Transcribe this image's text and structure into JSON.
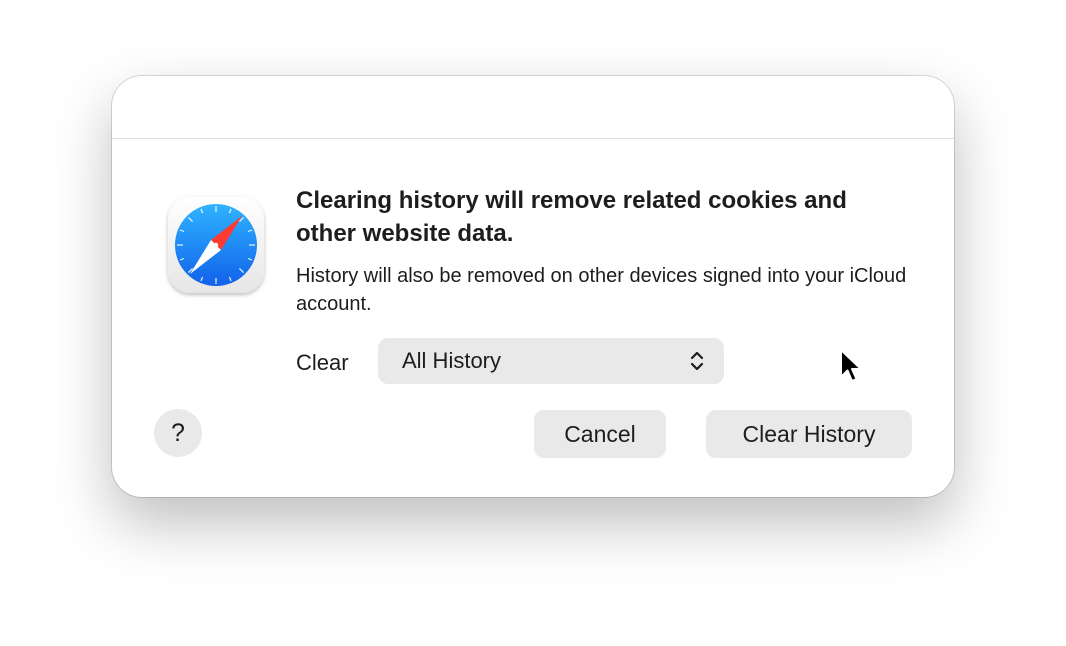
{
  "dialog": {
    "heading": "Clearing history will remove related cookies and other website data.",
    "message": "History will also be removed on other devices signed into your iCloud account.",
    "clear_label": "Clear",
    "clear_popup": {
      "selected": "All History"
    },
    "buttons": {
      "help_label": "?",
      "cancel_label": "Cancel",
      "clear_history_label": "Clear History"
    },
    "app_icon": "safari-compass-icon"
  },
  "colors": {
    "icon_blue": "#1a86f5",
    "needle_red": "#ff3b30",
    "button_bg": "#e9e9e9",
    "text": "#1d1d1f"
  }
}
